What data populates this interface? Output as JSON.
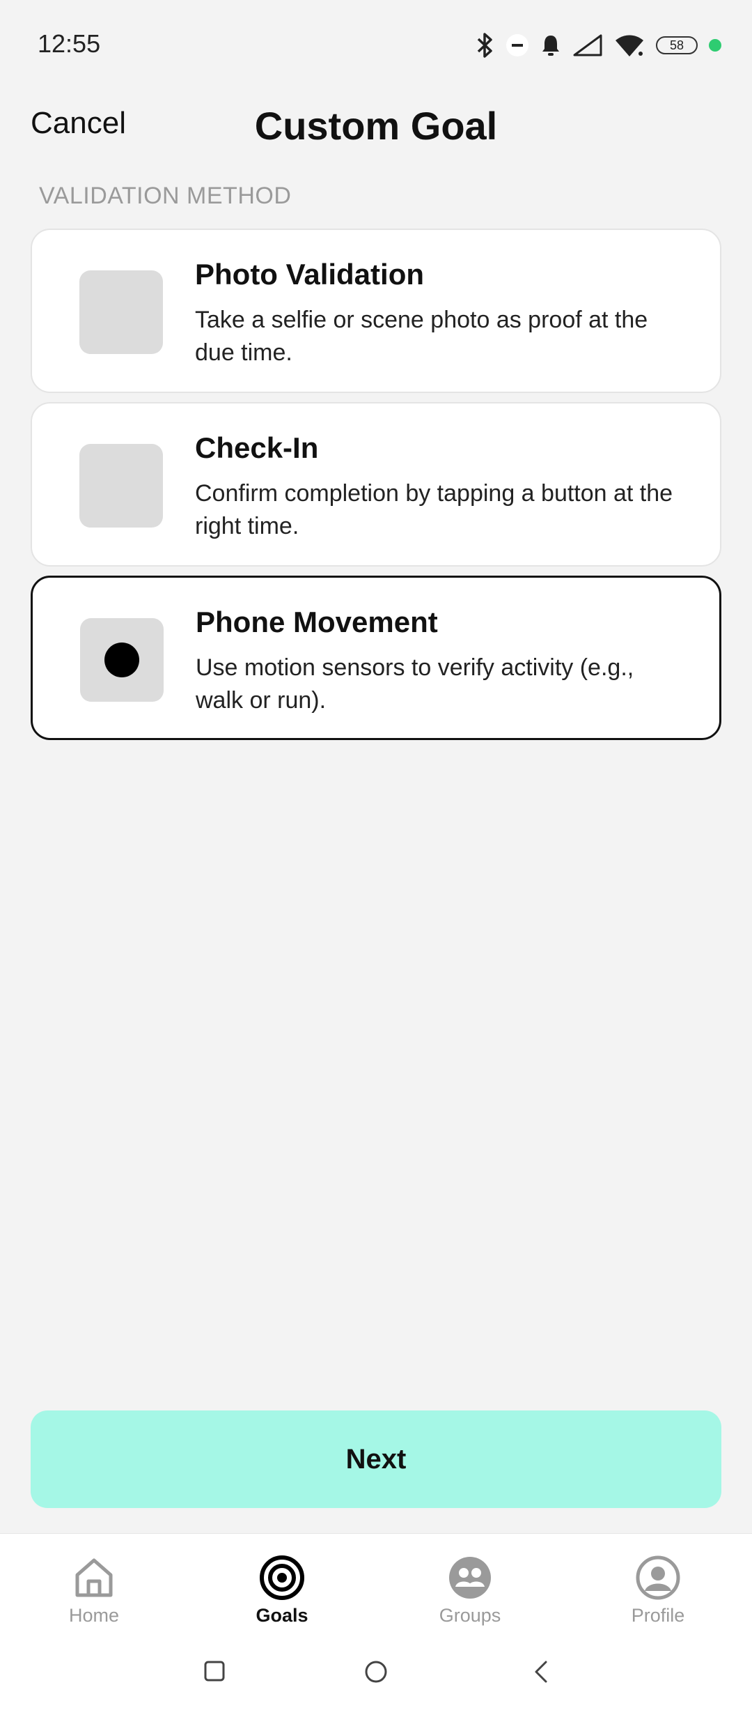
{
  "status_bar": {
    "time": "12:55",
    "battery": "58",
    "icons": [
      "bluetooth-icon",
      "do-not-disturb-icon",
      "bell-icon",
      "signal-icon",
      "wifi-icon",
      "battery-icon"
    ],
    "dot_color": "#2ecc71"
  },
  "header": {
    "cancel_label": "Cancel",
    "title": "Custom Goal"
  },
  "section_label": "VALIDATION METHOD",
  "options": [
    {
      "title": "Photo Validation",
      "description": "Take a selfie or scene photo as proof at the due time.",
      "selected": false
    },
    {
      "title": "Check-In",
      "description": "Confirm completion by tapping a button at the right time.",
      "selected": false
    },
    {
      "title": "Phone Movement",
      "description": "Use motion sensors to verify activity (e.g., walk or run).",
      "selected": true
    }
  ],
  "next_label": "Next",
  "next_color": "#a5f7e6",
  "bottom_nav": [
    {
      "label": "Home",
      "icon": "home-icon",
      "active": false
    },
    {
      "label": "Goals",
      "icon": "target-icon",
      "active": true
    },
    {
      "label": "Groups",
      "icon": "groups-icon",
      "active": false
    },
    {
      "label": "Profile",
      "icon": "profile-icon",
      "active": false
    }
  ],
  "system_nav": [
    "recents-icon",
    "home-circle-icon",
    "back-icon"
  ]
}
